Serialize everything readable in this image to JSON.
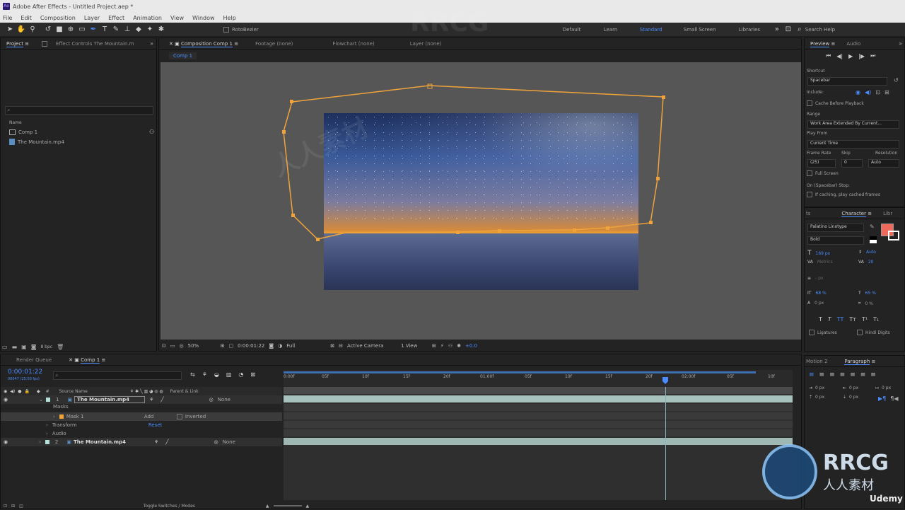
{
  "window": {
    "title": "Adobe After Effects - Untitled Project.aep *",
    "app_icon": "Ae"
  },
  "menu": [
    "File",
    "Edit",
    "Composition",
    "Layer",
    "Effect",
    "Animation",
    "View",
    "Window",
    "Help"
  ],
  "toolbar": {
    "rotobezier_label": "RotoBezier",
    "workspaces": [
      "Default",
      "Learn",
      "Standard",
      "Small Screen",
      "Libraries"
    ],
    "active_workspace": "Standard",
    "search_help_placeholder": "Search Help"
  },
  "project": {
    "tab_label": "Project",
    "effect_controls_label": "Effect Controls The Mountain.m",
    "name_header": "Name",
    "items": [
      "Comp 1",
      "The Mountain.mp4"
    ],
    "bpc": "8 bpc"
  },
  "composition": {
    "tabs": [
      "Composition Comp 1",
      "Footage (none)",
      "Flowchart (none)",
      "Layer (none)"
    ],
    "breadcrumb": "Comp 1",
    "footer": {
      "zoom": "50%",
      "timecode": "0:00:01:22",
      "resolution": "Full",
      "camera": "Active Camera",
      "view": "1 View",
      "exposure": "+0.0"
    }
  },
  "timeline": {
    "render_queue": "Render Queue",
    "comp_tab": "Comp 1",
    "current_time": "0:00:01:22",
    "frame_sub": "00047 (25.00 fps)",
    "headers": {
      "source_name": "Source Name",
      "parent": "Parent & Link"
    },
    "ruler": [
      "0:00f",
      "05f",
      "10f",
      "15f",
      "20f",
      "01:00f",
      "05f",
      "10f",
      "15f",
      "20f",
      "02:00f",
      "05f",
      "10f"
    ],
    "layers": [
      {
        "num": "1",
        "name": "The Mountain.mp4",
        "parent": "None"
      },
      {
        "num": "2",
        "name": "The Mountain.mp4",
        "parent": "None"
      }
    ],
    "masks_label": "Masks",
    "mask1": {
      "name": "Mask 1",
      "mode": "Add",
      "inverted": "Inverted"
    },
    "transform_label": "Transform",
    "reset_label": "Reset",
    "audio_label": "Audio",
    "toggle_label": "Toggle Switches / Modes"
  },
  "preview": {
    "tab": "Preview",
    "audio_tab": "Audio",
    "shortcut_label": "Shortcut",
    "shortcut_value": "Spacebar",
    "include_label": "Include:",
    "cache_before": "Cache Before Playback",
    "range_label": "Range",
    "range_value": "Work Area Extended By Current...",
    "play_from_label": "Play From",
    "play_from_value": "Current Time",
    "frame_rate_label": "Frame Rate",
    "frame_rate_value": "(25)",
    "skip_label": "Skip",
    "skip_value": "0",
    "resolution_label": "Resolution",
    "resolution_value": "Auto",
    "full_screen": "Full Screen",
    "stop_label": "On (Spacebar) Stop:",
    "if_caching": "If caching, play cached frames"
  },
  "character": {
    "tab": "Character",
    "lib_tab": "Libr",
    "font": "Palatino Linotype",
    "style": "Bold",
    "size": "169 px",
    "leading": "Auto",
    "kerning": "Metrics",
    "tracking": "20",
    "stroke": "- px",
    "vscale": "68 %",
    "hscale": "65 %",
    "baseline": "0 px",
    "tsume": "0 %",
    "ligatures": "Ligatures",
    "hindi": "Hindi Digits",
    "fill_color": "#f0695a"
  },
  "paragraph": {
    "tab": "Paragraph",
    "other_tab": "Motion 2",
    "indent_values": [
      "0 px",
      "0 px",
      "0 px",
      "0 px",
      "0 px"
    ]
  },
  "watermarks": {
    "brand": "RRCG",
    "brand_sub": "人人素材",
    "udemy": "Udemy"
  }
}
